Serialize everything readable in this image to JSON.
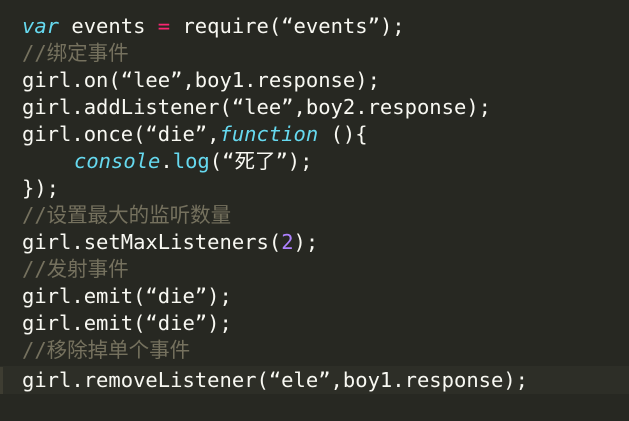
{
  "code": {
    "l1": {
      "var": "var",
      "a": " events ",
      "eq": "=",
      "b": " require(“events”);"
    },
    "l2": {
      "comment": "//绑定事件"
    },
    "l3": {
      "text": "girl.on(“lee”,boy1.response);"
    },
    "l4": {
      "text": "girl.addListener(“lee”,boy2.response);"
    },
    "l5": {
      "a": "girl.once(“die”,",
      "fn_kw": "function",
      "b": " (){"
    },
    "l6": {
      "console": "console",
      "dot": ".",
      "log": "log",
      "b": "(“死了”);"
    },
    "l7": {
      "text": "});"
    },
    "l8": {
      "comment": "//设置最大的监听数量"
    },
    "l9": {
      "a": "girl.setMaxListeners(",
      "num": "2",
      "b": ");"
    },
    "l10": {
      "comment": "//发射事件"
    },
    "l11": {
      "text": "girl.emit(“die”);"
    },
    "l12": {
      "text": "girl.emit(“die”);"
    },
    "l13": {
      "comment": "//移除掉单个事件"
    },
    "l14": {
      "text": "girl.removeListener(“ele”,boy1.response);"
    }
  },
  "colors": {
    "background": "#272822",
    "text": "#f8f8f2",
    "keyword": "#66d9ef",
    "operator": "#f92672",
    "comment": "#75715e",
    "number": "#ae81ff"
  }
}
